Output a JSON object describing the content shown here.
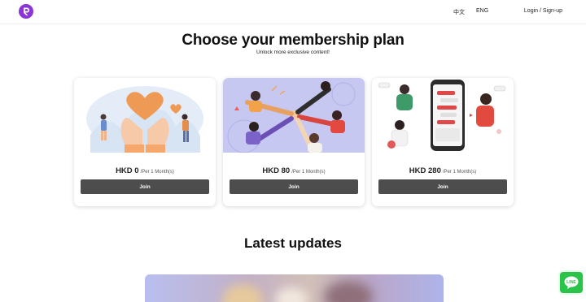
{
  "header": {
    "logo_icon": "r-logo-icon",
    "lang_zh": "中文",
    "lang_en": "ENG",
    "login_label": "Login / Sign-up"
  },
  "hero": {
    "title": "Choose your membership plan",
    "subtitle": "Unlock more exclusive content!"
  },
  "plans": [
    {
      "price": "HKD 0",
      "period": "/Per 1 Month(s)",
      "join_label": "Join",
      "illustration": "hands-heart-illustration"
    },
    {
      "price": "HKD 80",
      "period": "/Per 1 Month(s)",
      "join_label": "Join",
      "illustration": "team-hands-illustration"
    },
    {
      "price": "HKD 280",
      "period": "/Per 1 Month(s)",
      "join_label": "Join",
      "illustration": "phone-chat-illustration"
    }
  ],
  "latest": {
    "title": "Latest updates"
  },
  "chat": {
    "icon": "line-chat-icon",
    "label": "LINE"
  },
  "colors": {
    "brand": "#8b34d8",
    "button": "#4d4d4d",
    "chat": "#2cc34a",
    "card2_bg": "#c7c8f2"
  }
}
